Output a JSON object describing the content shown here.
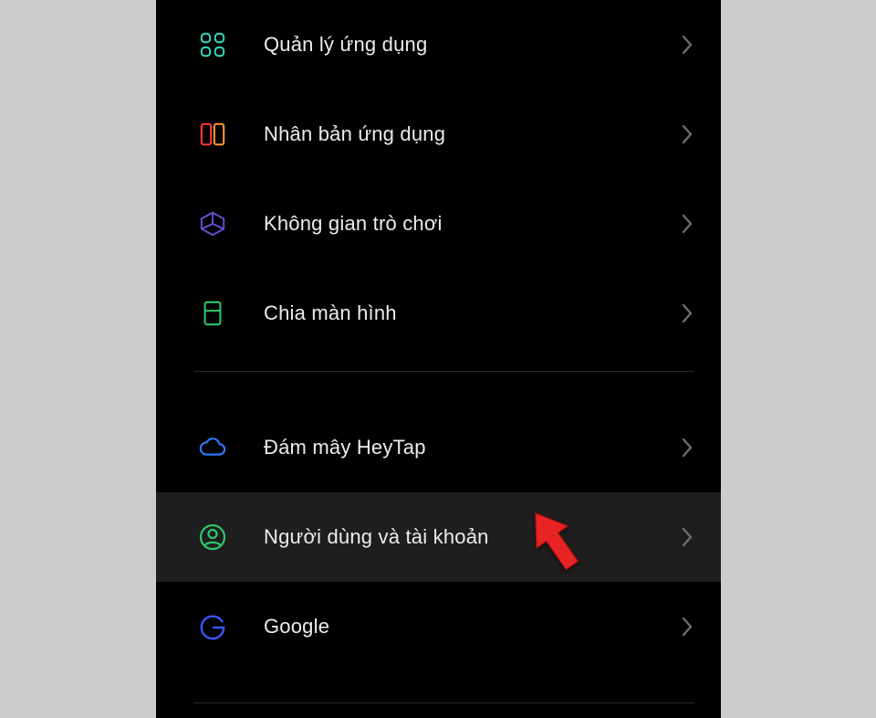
{
  "rows": [
    {
      "id": "quan-ly-ung-dung",
      "label": "Quản lý ứng dụng"
    },
    {
      "id": "nhan-ban-ung-dung",
      "label": "Nhân bản ứng dụng"
    },
    {
      "id": "khong-gian-tro-choi",
      "label": "Không gian trò chơi"
    },
    {
      "id": "chia-man-hinh",
      "label": "Chia màn hình"
    },
    {
      "id": "dam-may-heytap",
      "label": "Đám mây HeyTap"
    },
    {
      "id": "nguoi-dung-tai-khoan",
      "label": "Người dùng và tài khoản"
    },
    {
      "id": "google",
      "label": "Google"
    }
  ],
  "colors": {
    "chevron": "#6d6d6d",
    "divider": "#2a2a2a",
    "highlight_bg": "#1e1e1e",
    "callout_arrow": "#e72323",
    "icon_teal": "#31d2b4",
    "icon_orange": "#ff7a2f",
    "icon_purple": "#6b4fd8",
    "icon_green": "#2fc56a",
    "icon_blue": "#2f7cff"
  },
  "highlighted_row": "nguoi-dung-tai-khoan"
}
